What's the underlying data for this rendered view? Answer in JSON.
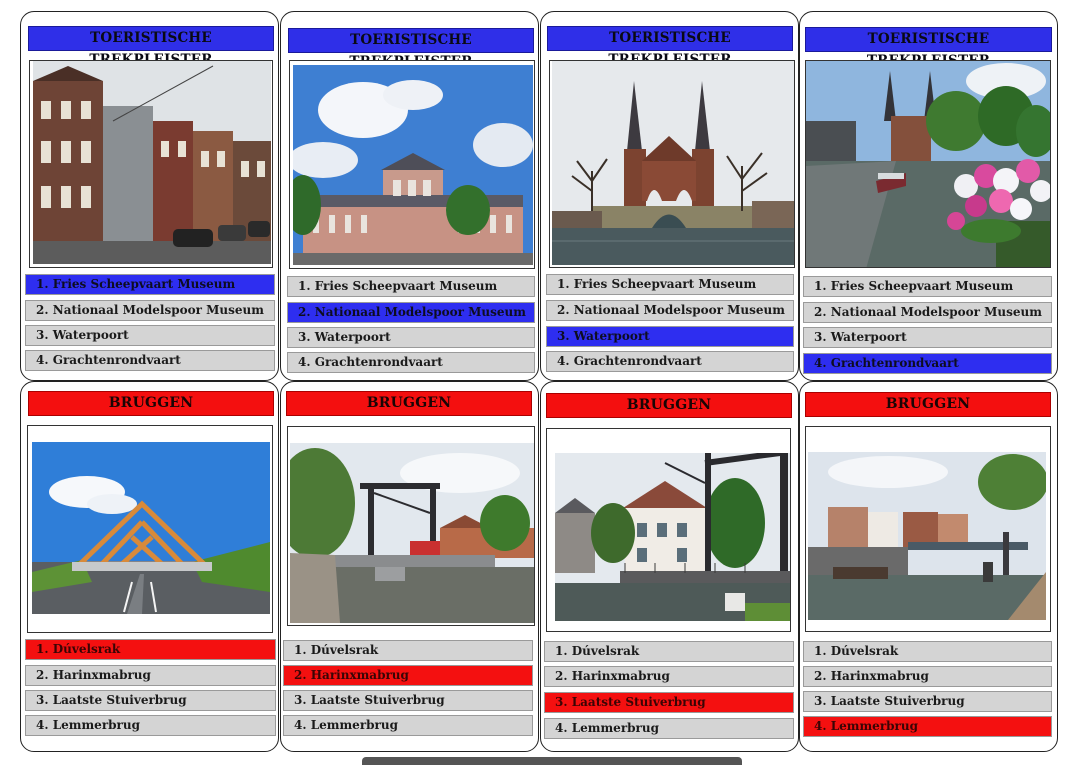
{
  "rows": [
    {
      "header": "TOERISTISCHE TREKPLEISTER",
      "options": [
        "Fries Scheepvaart Museum",
        "Nationaal Modelspoor Museum",
        "Waterpoort",
        "Grachtenrondvaart"
      ],
      "cards": [
        {
          "selected": 0,
          "photo": "museum-street-photo"
        },
        {
          "selected": 1,
          "photo": "station-building-photo"
        },
        {
          "selected": 2,
          "photo": "waterpoort-gate-photo"
        },
        {
          "selected": 3,
          "photo": "canal-boat-tour-photo"
        }
      ]
    },
    {
      "header": "BRUGGEN",
      "options": [
        "Dúvelsrak",
        "Harinxmabrug",
        "Laatste Stuiverbrug",
        "Lemmerbrug"
      ],
      "cards": [
        {
          "selected": 0,
          "photo": "wooden-arch-bridge-photo"
        },
        {
          "selected": 1,
          "photo": "bascule-bridge-photo"
        },
        {
          "selected": 2,
          "photo": "drawbridge-photo"
        },
        {
          "selected": 3,
          "photo": "lift-bridge-photo"
        }
      ]
    }
  ],
  "colors": {
    "select_top": "#2e2ef0",
    "select_bottom": "#f41010",
    "option_bg": "#d4d4d4"
  }
}
